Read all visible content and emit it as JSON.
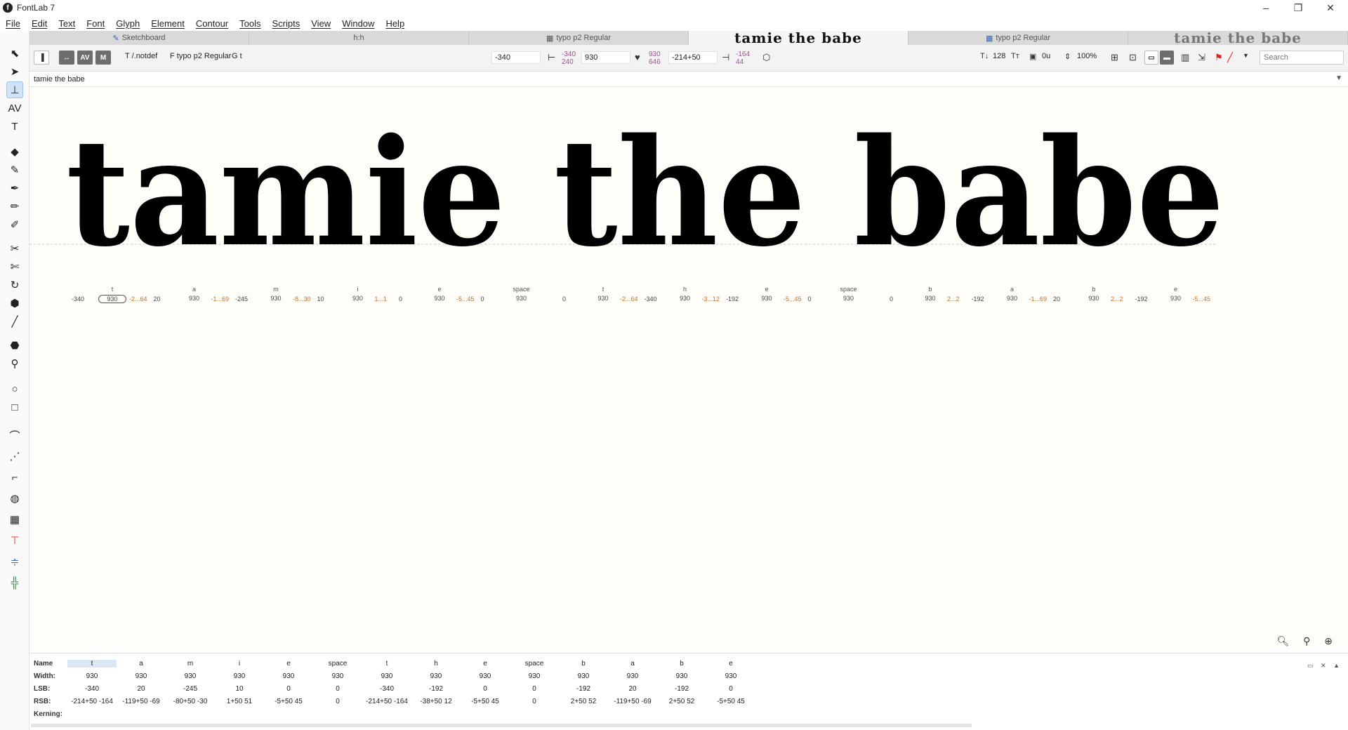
{
  "window": {
    "app_title": "FontLab 7",
    "controls": [
      "–",
      "❐",
      "✕"
    ]
  },
  "menu": [
    "File",
    "Edit",
    "Text",
    "Font",
    "Glyph",
    "Element",
    "Contour",
    "Tools",
    "Scripts",
    "View",
    "Window",
    "Help"
  ],
  "tabs": [
    {
      "label": "Sketchboard",
      "icon": "pencil-icon",
      "kind": "text"
    },
    {
      "label": "h:h",
      "icon": "",
      "kind": "text"
    },
    {
      "label": "typo p2 Regular",
      "icon": "font-grid-icon",
      "kind": "text"
    },
    {
      "label": "tamie the babe",
      "icon": "",
      "kind": "preview"
    },
    {
      "label": "typo p2 Regular",
      "icon": "font-grid-icon",
      "kind": "text"
    },
    {
      "label": "tamie the babe",
      "icon": "",
      "kind": "preview-dim"
    }
  ],
  "propbar": {
    "btn1": "",
    "btn2": "AV",
    "btn3": "M",
    "glyph_notdef": "T /.notdef",
    "font_name": "F typo p2 Regular",
    "glyph_t": "G t",
    "lsb_value": "-340",
    "lsb_sub_top": "-340",
    "lsb_sub_bottom": "240",
    "width_value": "930",
    "width_sub_top": "930",
    "width_sub_bottom": "646",
    "rsb_value": "-214+50",
    "rsb_sub_top": "-164",
    "rsb_sub_bottom": "44",
    "font_size": "128",
    "units": "0u",
    "zoom": "100%",
    "search_placeholder": "Search"
  },
  "text_field": "tamie the babe",
  "canvas_text": "tamie the babe",
  "glyph_metrics": [
    {
      "name": "t",
      "lsb": "-340",
      "width": "930",
      "rsb": "-2...64"
    },
    {
      "name": "a",
      "lsb": "20",
      "width": "930",
      "rsb": "-1...69"
    },
    {
      "name": "m",
      "lsb": "-245",
      "width": "930",
      "rsb": "-8...30"
    },
    {
      "name": "i",
      "lsb": "10",
      "width": "930",
      "rsb": "1...1"
    },
    {
      "name": "e",
      "lsb": "0",
      "width": "930",
      "rsb": "-5...45"
    },
    {
      "name": "space",
      "lsb": "0",
      "width": "930",
      "rsb": ""
    },
    {
      "name": "t",
      "lsb": "0",
      "width": "930",
      "rsb": "-2...64"
    },
    {
      "name": "h",
      "lsb": "-340",
      "width": "930",
      "rsb": "-3...12"
    },
    {
      "name": "e",
      "lsb": "-192",
      "width": "930",
      "rsb": "-5...45"
    },
    {
      "name": "space",
      "lsb": "0",
      "width": "930",
      "rsb": ""
    },
    {
      "name": "b",
      "lsb": "0",
      "width": "930",
      "rsb": "2...2"
    },
    {
      "name": "a",
      "lsb": "-192",
      "width": "930",
      "rsb": "-1...69"
    },
    {
      "name": "b",
      "lsb": "20",
      "width": "930",
      "rsb": "2...2"
    },
    {
      "name": "e",
      "lsb": "-192",
      "width": "930",
      "rsb": "-5...45"
    }
  ],
  "metrics_table": {
    "labels": [
      "Name",
      "Width:",
      "LSB:",
      "RSB:",
      "Kerning:"
    ],
    "names": [
      "t",
      "a",
      "m",
      "i",
      "e",
      "space",
      "t",
      "h",
      "e",
      "space",
      "b",
      "a",
      "b",
      "e"
    ],
    "widths": [
      "930",
      "930",
      "930",
      "930",
      "930",
      "930",
      "930",
      "930",
      "930",
      "930",
      "930",
      "930",
      "930",
      "930"
    ],
    "lsbs": [
      "-340",
      "20",
      "-245",
      "10",
      "0",
      "0",
      "-340",
      "-192",
      "0",
      "0",
      "-192",
      "20",
      "-192",
      "0"
    ],
    "rsbs": [
      "-214+50 -164",
      "-119+50 -69",
      "-80+50 -30",
      "1+50 51",
      "-5+50 45",
      "0",
      "-214+50 -164",
      "-38+50 12",
      "-5+50 45",
      "0",
      "2+50 52",
      "-119+50 -69",
      "2+50 52",
      "-5+50 45"
    ]
  },
  "colors": {
    "accent": "#cfe3f7",
    "rsb_orange": "#c6712f",
    "sub_purple": "#a0508a"
  }
}
